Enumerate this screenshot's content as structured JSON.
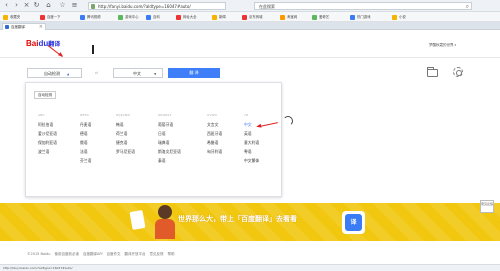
{
  "browser": {
    "url": "http://fanyi.baidu.com/?aldtype=16047#auto/",
    "search_text": "在此搜索",
    "tab_title": "百度翻译",
    "tab_close": "×"
  },
  "bookmarks": [
    {
      "label": "收藏夹",
      "color": "#f5b400"
    },
    {
      "label": "百度一下",
      "color": "#e33"
    },
    {
      "label": "腾讯视频",
      "color": "#3a7cf5"
    },
    {
      "label": "游戏中心",
      "color": "#5bb85d"
    },
    {
      "label": "百科",
      "color": "#3a7cf5"
    },
    {
      "label": "网址大全",
      "color": "#e33"
    },
    {
      "label": "新闻",
      "color": "#f5b400"
    },
    {
      "label": "京东商城",
      "color": "#e33"
    },
    {
      "label": "淘宝网",
      "color": "#f90"
    },
    {
      "label": "爱奇艺",
      "color": "#5bb85d"
    },
    {
      "label": "热门游戏",
      "color": "#3a7cf5"
    },
    {
      "label": "小说",
      "color": "#f5b400"
    }
  ],
  "header": {
    "logo_bai": "Bai",
    "logo_du": "du",
    "logo_fy": "翻译",
    "user_label": "梦醒秋霜的世界"
  },
  "langbar": {
    "source": "自动检测",
    "swap": "⇄",
    "target": "中文",
    "translate": "翻 译"
  },
  "dropdown": {
    "detect": "自动检测",
    "columns": [
      {
        "header": "ABC",
        "items": [
          "阿拉伯语",
          "爱沙尼亚语",
          "保加利亚语",
          "波兰语"
        ]
      },
      {
        "header": "DEFG",
        "items": [
          "丹麦语",
          "德语",
          "俄语",
          "法语",
          "芬兰语"
        ]
      },
      {
        "header": "HIJKLMN",
        "items": [
          "韩语",
          "荷兰语",
          "捷克语",
          "罗马尼亚语"
        ]
      },
      {
        "header": "OPQRST",
        "items": [
          "葡萄牙语",
          "日语",
          "瑞典语",
          "斯洛文尼亚语",
          "泰语"
        ]
      },
      {
        "header": "UVWX",
        "items": [
          "文言文",
          "西班牙语",
          "希腊语",
          "匈牙利语"
        ]
      },
      {
        "header": "YZ",
        "items": [
          "中文",
          "英语",
          "意大利语",
          "粤语",
          "中文繁体"
        ]
      }
    ]
  },
  "banner": {
    "slogan": "世界那么大，带上「百度翻译」去看看",
    "badge": "译"
  },
  "side_feedback": "意见反馈",
  "footer": [
    "©2015 Baidu",
    "使用百度前必读",
    "百度翻译API",
    "百度作文",
    "翻译开放平台",
    "意见反馈",
    "帮助"
  ],
  "statusbar": "http://fanyi.baidu.com/?aldtype=16047#auto/"
}
